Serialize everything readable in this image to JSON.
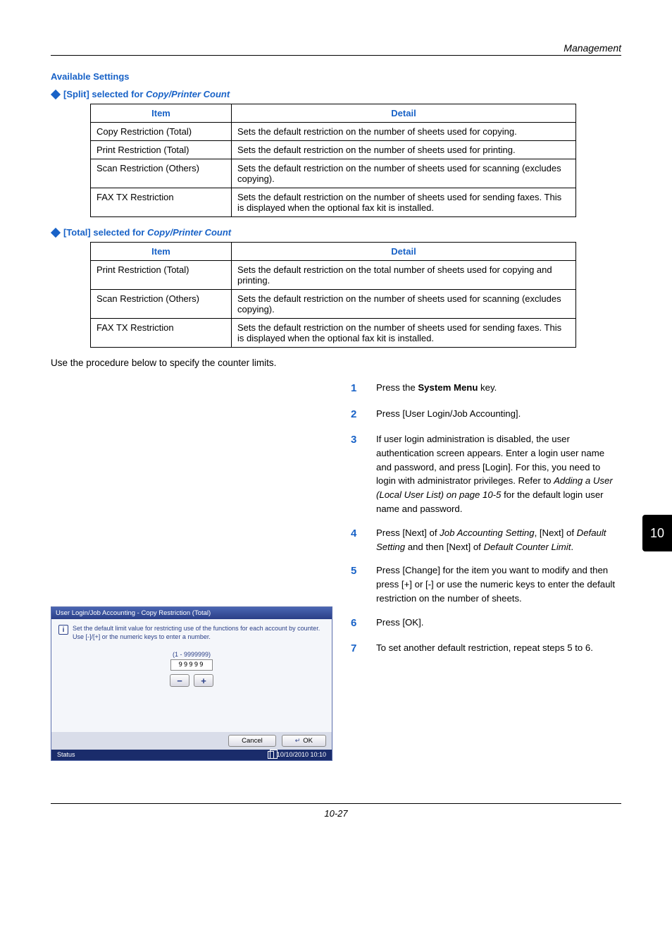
{
  "chapter_header": "Management",
  "avail_heading": "Available Settings",
  "split_heading_prefix": "[Split] selected for ",
  "split_heading_ital": "Copy/Printer Count",
  "total_heading_prefix": "[Total] selected for ",
  "total_heading_ital": "Copy/Printer Count",
  "th_item": "Item",
  "th_detail": "Detail",
  "split_rows": [
    {
      "item": "Copy Restriction (Total)",
      "detail": "Sets the default restriction on the number of sheets used for copying."
    },
    {
      "item": "Print Restriction (Total)",
      "detail": "Sets the default restriction on the number of sheets used for printing."
    },
    {
      "item": "Scan Restriction (Others)",
      "detail": "Sets the default restriction on the number of sheets used for scanning (excludes copying)."
    },
    {
      "item": "FAX TX Restriction",
      "detail": "Sets the default restriction on the number of sheets used for sending faxes. This is displayed when the optional fax kit is installed."
    }
  ],
  "total_rows": [
    {
      "item": "Print Restriction (Total)",
      "detail": "Sets the default restriction on the total number of sheets used for copying and printing."
    },
    {
      "item": "Scan Restriction (Others)",
      "detail": "Sets the default restriction on the number of sheets used for scanning (excludes copying)."
    },
    {
      "item": "FAX TX Restriction",
      "detail": "Sets the default restriction on the number of sheets used for sending faxes. This is displayed when the optional fax kit is installed."
    }
  ],
  "intro": "Use the procedure below to specify the counter limits.",
  "steps": {
    "s1_a": "Press the ",
    "s1_b": "System Menu",
    "s1_c": " key.",
    "s2": "Press [User Login/Job Accounting].",
    "s3_a": "If user login administration is disabled, the user authentication screen appears. Enter a login user name and password, and press [Login]. For this, you need to login with administrator privileges. Refer to ",
    "s3_i": "Adding a User (Local User List) on page 10-5",
    "s3_c": " for the default login user name and password.",
    "s4_a": "Press [Next] of ",
    "s4_i1": "Job Accounting Setting",
    "s4_b": ", [Next] of ",
    "s4_i2": "Default Setting",
    "s4_c": " and then [Next] of ",
    "s4_i3": "Default Counter Limit",
    "s4_d": ".",
    "s5": "Press [Change] for the item you want to modify and then press [+] or [-] or use the numeric keys to enter the default restriction on the number of sheets.",
    "s6": "Press [OK].",
    "s7": "To set another default restriction, repeat steps 5 to 6."
  },
  "dialog": {
    "title": "User Login/Job Accounting - Copy Restriction (Total)",
    "info1": "Set the default limit value for restricting use of the functions for each account by counter.",
    "info2": "Use [-]/[+] or the numeric keys to enter a number.",
    "range": "(1 - 9999999)",
    "value": "99999",
    "minus": "−",
    "plus": "+",
    "cancel": "Cancel",
    "ok": "OK",
    "enter_glyph": "↵",
    "status": "Status",
    "timestamp": "10/10/2010  10:10"
  },
  "side_tab": "10",
  "page_num": "10-27",
  "nums": {
    "n1": "1",
    "n2": "2",
    "n3": "3",
    "n4": "4",
    "n5": "5",
    "n6": "6",
    "n7": "7"
  }
}
